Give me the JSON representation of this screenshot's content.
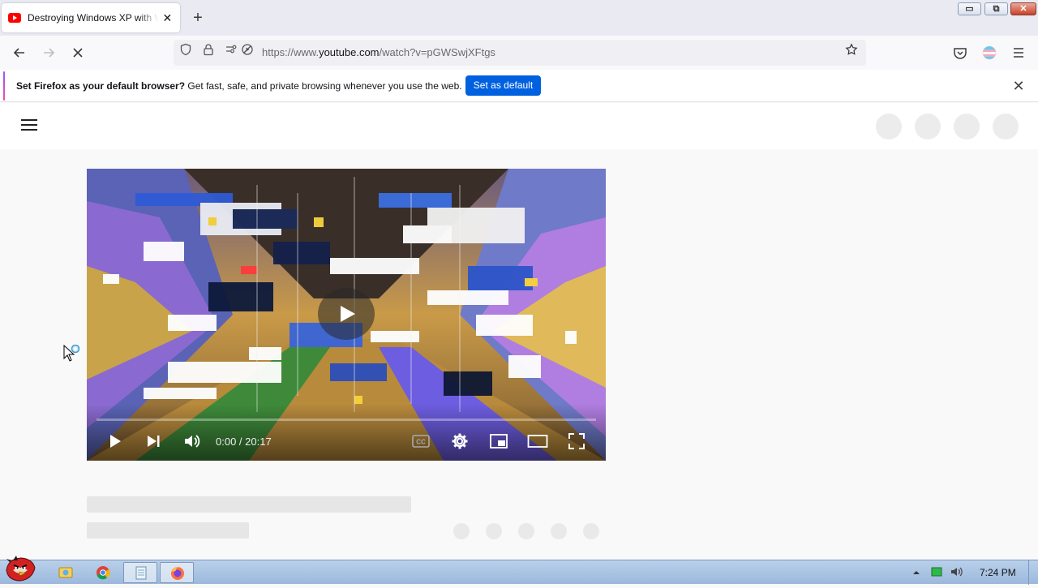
{
  "browser": {
    "tab": {
      "title": "Destroying Windows XP with W",
      "icon": "youtube-favicon"
    },
    "new_tab_label": "+",
    "window_controls": {
      "minimize": "▭",
      "maximize": "⧉",
      "close": "✕"
    },
    "address": {
      "prefix": "https://www.",
      "domain": "youtube.com",
      "path": "/watch?v=pGWSwjXFtgs"
    }
  },
  "notification": {
    "bold": "Set Firefox as your default browser?",
    "text": " Get fast, safe, and private browsing whenever you use the web.",
    "button": "Set as default",
    "close": "✕"
  },
  "player": {
    "time_current": "0:00",
    "time_total": "20:17",
    "time_display": "0:00 / 20:17",
    "progress": 0,
    "cc_label": "CC"
  },
  "taskbar": {
    "clock": "7:24 PM",
    "apps": [
      "angry-birds-start-icon",
      "explorer-icon",
      "chrome-icon",
      "notepad-icon",
      "firefox-icon"
    ]
  },
  "colors": {
    "youtube_red": "#ff0000",
    "firefox_blue": "#0061e0"
  }
}
